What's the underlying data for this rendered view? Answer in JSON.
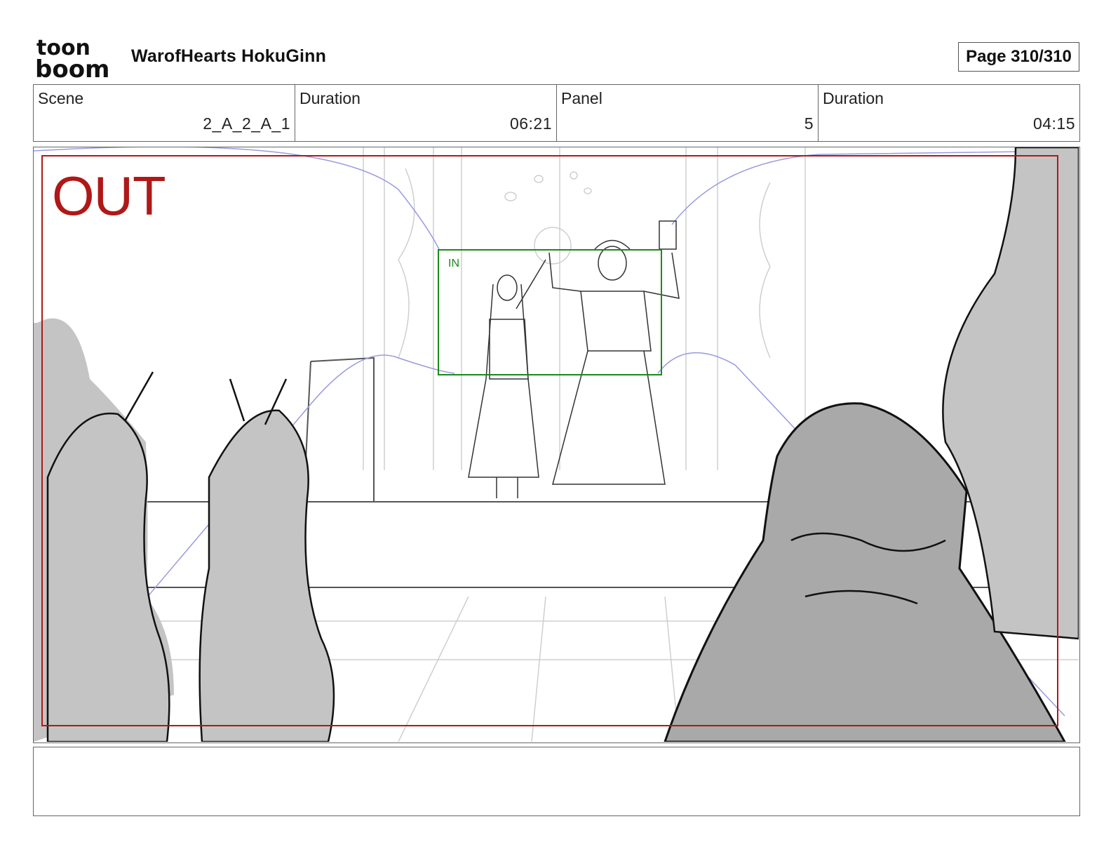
{
  "header": {
    "logo_text_top": "toon",
    "logo_text_bottom": "boom",
    "project_title": "WarofHearts HokuGinn",
    "page_label": "Page 310/310"
  },
  "info": {
    "scene_label": "Scene",
    "scene_value": "2_A_2_A_1",
    "scene_duration_label": "Duration",
    "scene_duration_value": "06:21",
    "panel_label": "Panel",
    "panel_value": "5",
    "panel_duration_label": "Duration",
    "panel_duration_value": "04:15"
  },
  "panel": {
    "out_label": "OUT",
    "in_label": "IN",
    "out_frame_color": "#b01818",
    "in_frame_color": "#1a8a1a",
    "camera_path_color": "#9a9ae0",
    "shadow_color": "#c4c4c4"
  },
  "notes": {
    "text": ""
  }
}
